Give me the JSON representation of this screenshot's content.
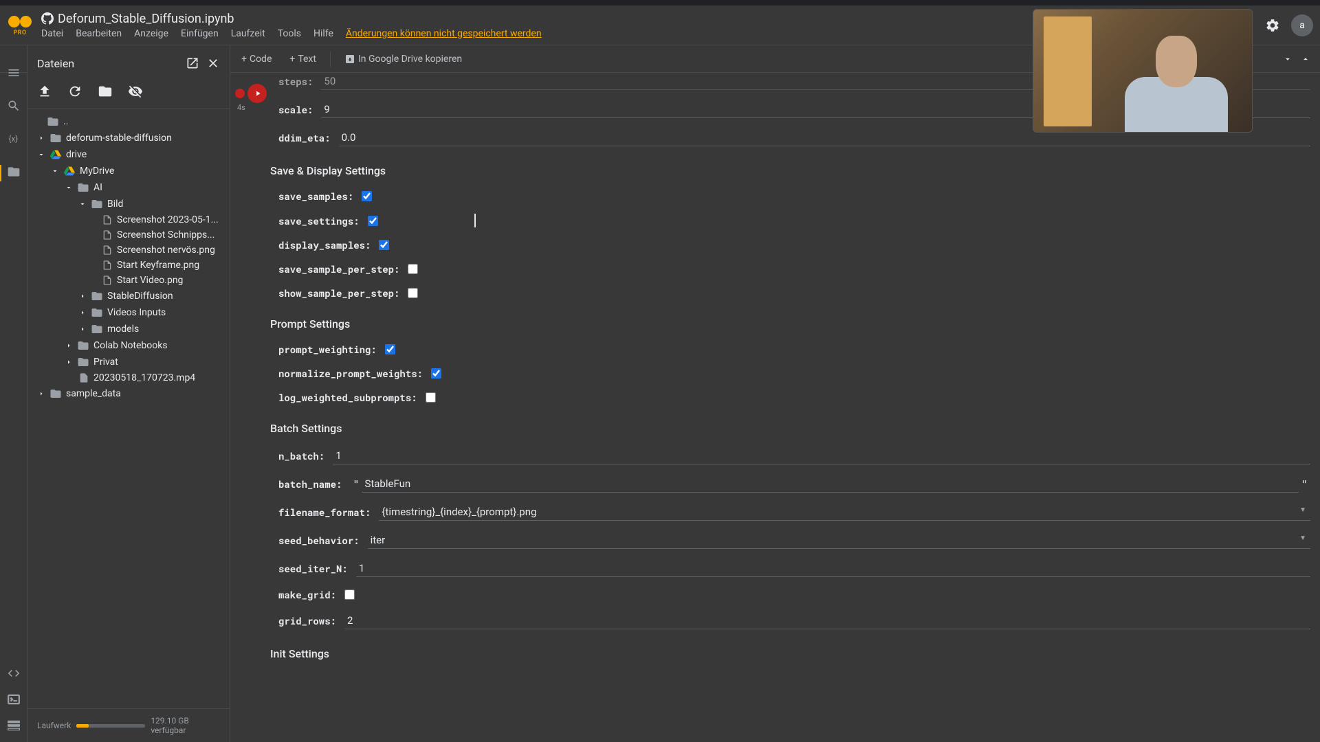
{
  "header": {
    "title": "Deforum_Stable_Diffusion.ipynb",
    "logo_sub": "PRO",
    "menu": [
      "Datei",
      "Bearbeiten",
      "Anzeige",
      "Einfügen",
      "Laufzeit",
      "Tools",
      "Hilfe"
    ],
    "warning": "Änderungen können nicht gespeichert werden",
    "avatar": "a"
  },
  "toolbar": {
    "code": "Code",
    "text": "Text",
    "drive": "In Google Drive kopieren"
  },
  "sidebar": {
    "title": "Dateien",
    "tree": {
      "root_parent": "..",
      "deforum": "deforum-stable-diffusion",
      "drive": "drive",
      "mydrive": "MyDrive",
      "ai": "AI",
      "bild": "Bild",
      "files": [
        "Screenshot 2023-05-1...",
        "Screenshot Schnipps...",
        "Screenshot nervös.png",
        "Start Keyframe.png",
        "Start Video.png"
      ],
      "sd": "StableDiffusion",
      "videos": "Videos Inputs",
      "models": "models",
      "colab_nb": "Colab Notebooks",
      "privat": "Privat",
      "mp4": "20230518_170723.mp4",
      "sample": "sample_data"
    },
    "storage_label": "Laufwerk",
    "storage_free": "129.10 GB verfügbar"
  },
  "params": {
    "steps_label": "steps:",
    "steps_value": "50",
    "scale_label": "scale:",
    "scale_value": "9",
    "ddim_label": "ddim_eta:",
    "ddim_value": "0.0",
    "section_save": "Save & Display Settings",
    "save_samples_label": "save_samples:",
    "save_settings_label": "save_settings:",
    "display_samples_label": "display_samples:",
    "save_sample_per_step_label": "save_sample_per_step:",
    "show_sample_per_step_label": "show_sample_per_step:",
    "section_prompt": "Prompt Settings",
    "prompt_weighting_label": "prompt_weighting:",
    "normalize_label": "normalize_prompt_weights:",
    "log_weighted_label": "log_weighted_subprompts:",
    "section_batch": "Batch Settings",
    "n_batch_label": "n_batch:",
    "n_batch_value": "1",
    "batch_name_label": "batch_name:",
    "batch_name_value": "StableFun",
    "filename_label": "filename_format:",
    "filename_value": "{timestring}_{index}_{prompt}.png",
    "seed_behavior_label": "seed_behavior:",
    "seed_behavior_value": "iter",
    "seed_iter_label": "seed_iter_N:",
    "seed_iter_value": "1",
    "make_grid_label": "make_grid:",
    "grid_rows_label": "grid_rows:",
    "grid_rows_value": "2",
    "section_init": "Init Settings"
  },
  "gutter_label": "4s"
}
